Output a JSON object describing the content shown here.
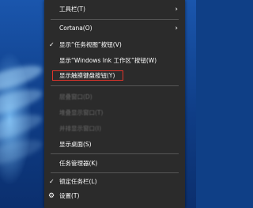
{
  "menu": {
    "items": [
      {
        "label": "工具栏(T)",
        "has_submenu": true
      },
      {
        "label": "Cortana(O)",
        "has_submenu": true
      },
      {
        "label": "显示“任务视图”按钮(V)",
        "checked": true
      },
      {
        "label": "显示“Windows Ink 工作区”按钮(W)"
      },
      {
        "label": "显示触摸键盘按钮(Y)",
        "highlighted": true
      },
      {
        "label": "层叠窗口(D)",
        "disabled": true
      },
      {
        "label": "堆叠显示窗口(T)",
        "disabled": true
      },
      {
        "label": "并排显示窗口(I)",
        "disabled": true
      },
      {
        "label": "显示桌面(S)"
      },
      {
        "label": "任务管理器(K)"
      },
      {
        "label": "锁定任务栏(L)",
        "checked": true
      },
      {
        "label": "设置(T)",
        "icon": "gear-icon"
      }
    ],
    "submenu_arrow": "›",
    "check_mark": "✓",
    "gear_glyph": "⚙"
  },
  "colors": {
    "menu_bg": "#2b2b2b",
    "highlight_border": "#e0342a",
    "disabled_text": "#6a6a6a",
    "desktop": "#0f3d86"
  }
}
